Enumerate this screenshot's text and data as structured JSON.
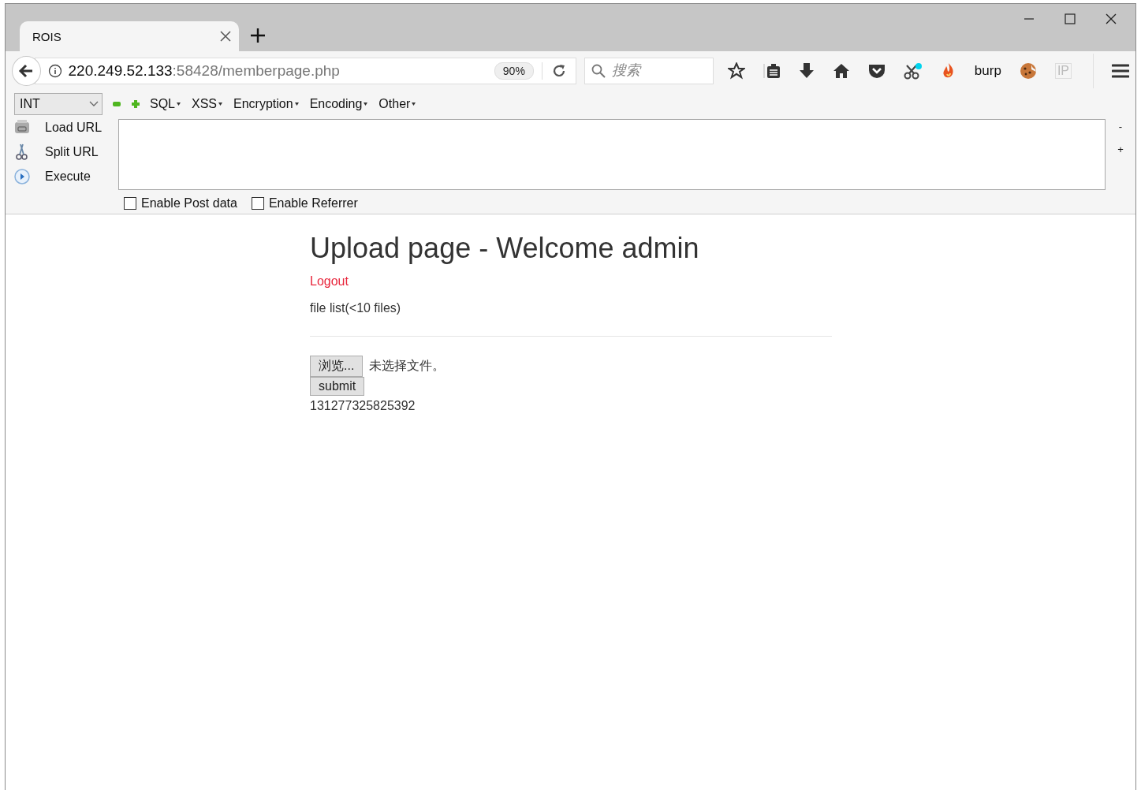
{
  "tabs": [
    {
      "label": "ROIS",
      "selected": true
    }
  ],
  "address_bar": {
    "host": "220.249.52.133",
    "path": ":58428/memberpage.php",
    "zoom": "90%"
  },
  "search": {
    "placeholder": "搜索"
  },
  "toolbar": {
    "burp_label": "burp",
    "ip_label": "IP"
  },
  "hackbar": {
    "dropdown": "INT",
    "menus": [
      "SQL",
      "XSS",
      "Encryption",
      "Encoding",
      "Other"
    ],
    "actions": [
      "Load URL",
      "Split URL",
      "Execute"
    ],
    "side_buttons": [
      "-",
      "+"
    ],
    "options": [
      {
        "label": "Enable Post data",
        "checked": false
      },
      {
        "label": "Enable Referrer",
        "checked": false
      }
    ]
  },
  "page": {
    "heading": "Upload page - Welcome admin",
    "logout": "Logout",
    "file_list": "file list(<10 files)",
    "browse_button": "浏览...",
    "no_file": "未选择文件。",
    "submit": "submit",
    "output": "131277325825392"
  }
}
